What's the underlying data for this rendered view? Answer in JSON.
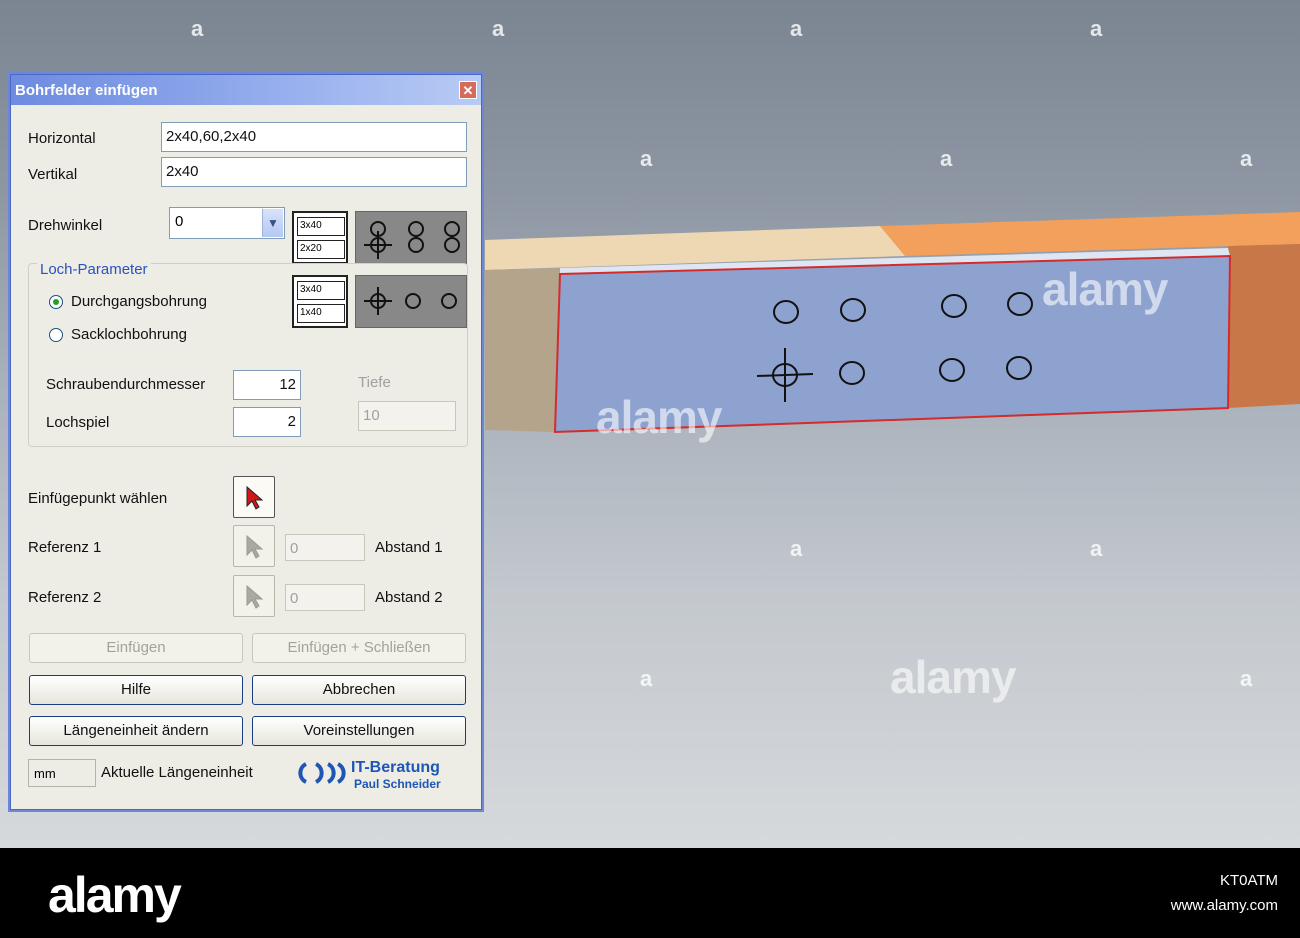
{
  "dialog": {
    "title": "Bohrfelder einfügen",
    "close_glyph": "✕",
    "horizontal": {
      "label": "Horizontal",
      "value": "2x40,60,2x40"
    },
    "vertical": {
      "label": "Vertikal",
      "value": "2x40"
    },
    "rotation": {
      "label": "Drehwinkel",
      "value": "0"
    },
    "pattern_option_1": {
      "cell_top": "3x40",
      "cell_bottom": "2x20"
    },
    "pattern_option_2": {
      "cell_top": "3x40",
      "cell_bottom": "1x40"
    },
    "hole_params": {
      "legend": "Loch-Parameter",
      "through_hole": {
        "label": "Durchgangsbohrung",
        "selected": true
      },
      "blind_hole": {
        "label": "Sacklochbohrung",
        "selected": false
      },
      "bolt_diameter": {
        "label": "Schraubendurchmesser",
        "value": "12"
      },
      "clearance": {
        "label": "Lochspiel",
        "value": "2"
      },
      "depth": {
        "label": "Tiefe",
        "value": "10"
      }
    },
    "insert_point": {
      "label": "Einfügepunkt wählen"
    },
    "reference_1": {
      "label": "Referenz 1",
      "value": "0",
      "distance_label": "Abstand 1"
    },
    "reference_2": {
      "label": "Referenz 2",
      "value": "0",
      "distance_label": "Abstand 2"
    },
    "buttons": {
      "insert": "Einfügen",
      "insert_close": "Einfügen + Schließen",
      "help": "Hilfe",
      "cancel": "Abbrechen",
      "change_unit": "Längeneinheit ändern",
      "defaults": "Voreinstellungen"
    },
    "unit": {
      "value": "mm",
      "label": "Aktuelle Längeneinheit"
    },
    "brand": {
      "line1": "IT-Beratung",
      "line2": "Paul Schneider"
    }
  },
  "watermark": {
    "glyph": "a",
    "word": "alamy",
    "bar_logo": "alamy",
    "image_id": "KT0ATM",
    "url": "www.alamy.com"
  },
  "colors": {
    "plate": "#8ea2d0",
    "plate_outline": "#d42b2b",
    "beam_light": "#eed8b4",
    "beam_orange": "#f2a05c",
    "beam_dark_orange": "#c87848",
    "beam_brown": "#b4a48c",
    "accent_blue": "#1e56b5"
  }
}
